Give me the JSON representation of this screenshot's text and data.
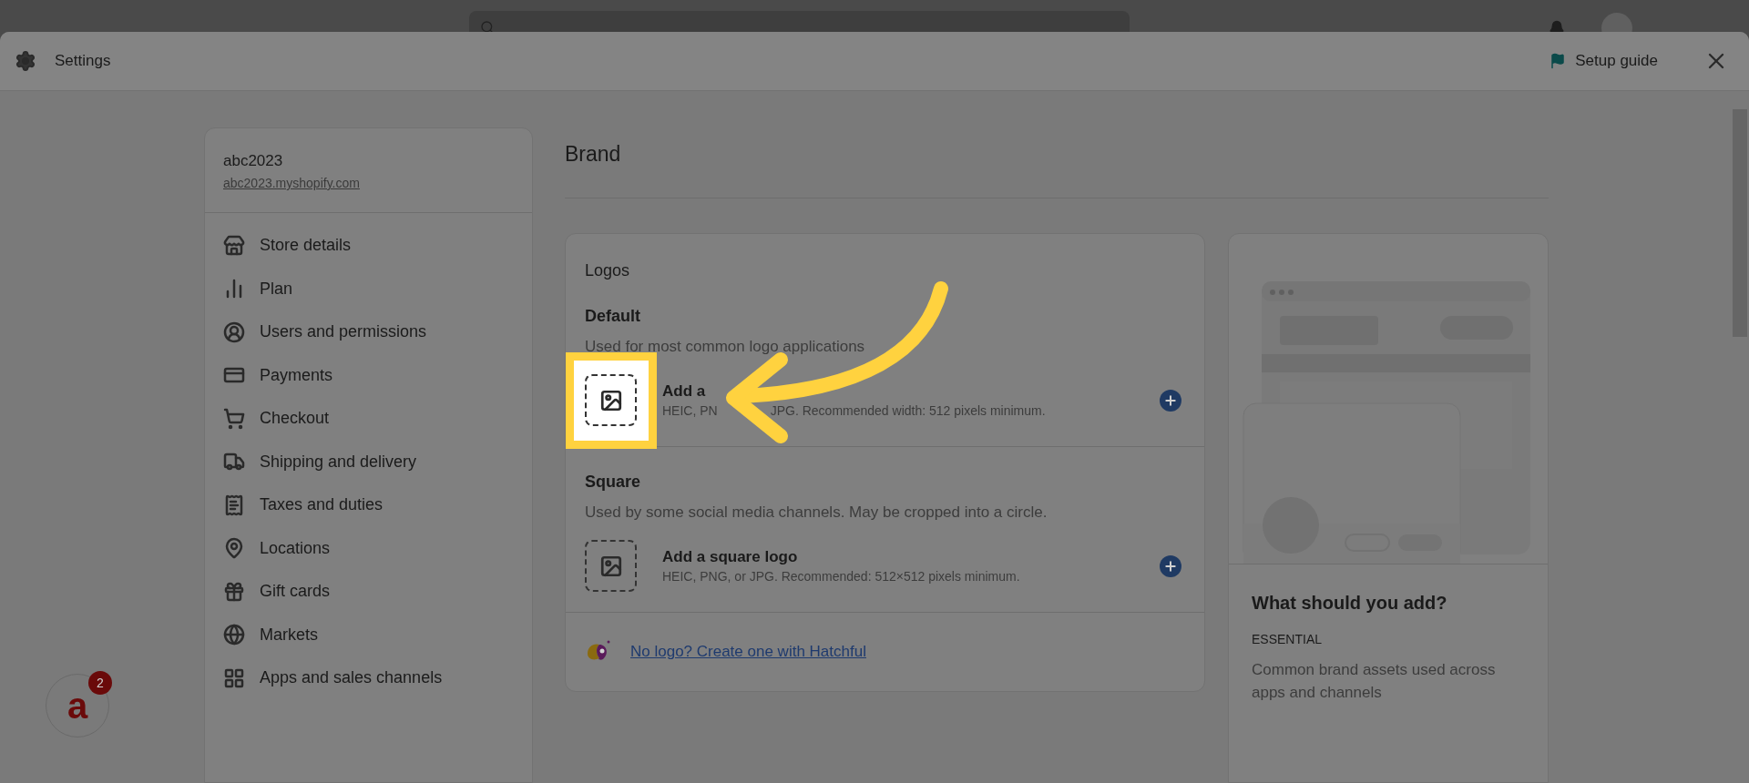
{
  "modal": {
    "title": "Settings",
    "setup_guide": "Setup guide"
  },
  "store": {
    "name": "abc2023",
    "url": "abc2023.myshopify.com"
  },
  "sidebar": {
    "items": [
      {
        "label": "Store details",
        "kind": "store"
      },
      {
        "label": "Plan",
        "kind": "plan"
      },
      {
        "label": "Users and permissions",
        "kind": "user"
      },
      {
        "label": "Payments",
        "kind": "payments"
      },
      {
        "label": "Checkout",
        "kind": "cart"
      },
      {
        "label": "Shipping and delivery",
        "kind": "truck"
      },
      {
        "label": "Taxes and duties",
        "kind": "receipt"
      },
      {
        "label": "Locations",
        "kind": "pin"
      },
      {
        "label": "Gift cards",
        "kind": "gift"
      },
      {
        "label": "Markets",
        "kind": "globe"
      },
      {
        "label": "Apps and sales channels",
        "kind": "apps"
      }
    ]
  },
  "page": {
    "title": "Brand"
  },
  "logos": {
    "title": "Logos",
    "sections": [
      {
        "heading": "Default",
        "description": "Used for most common logo applications",
        "action": "Add a",
        "hint": [
          "HEIC, PN",
          "JPG. Recommended width: 512 pixels minimum."
        ],
        "highlighted": true
      },
      {
        "heading": "Square",
        "description": "Used by some social media channels. May be cropped into a circle.",
        "action": "Add a square logo",
        "hint": [
          "HEIC, PNG, or JPG. Recommended: 512×512 pixels minimum."
        ],
        "highlighted": false
      }
    ],
    "link": "No logo? Create one with Hatchful"
  },
  "guide": {
    "title": "What should you add?",
    "label": "ESSENTIAL",
    "text": "Common brand assets used across apps and channels"
  },
  "chat": {
    "letter": "a",
    "badge": "2"
  }
}
